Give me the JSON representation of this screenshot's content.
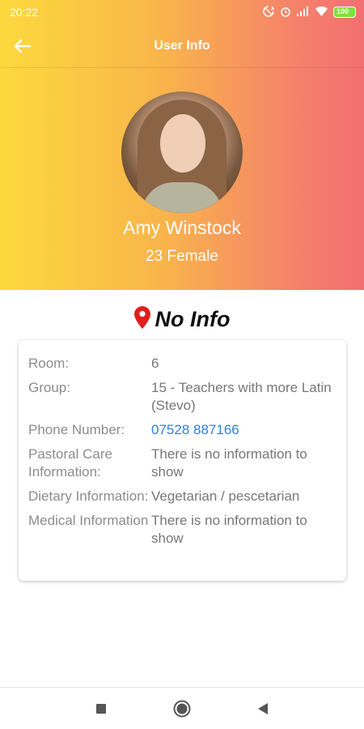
{
  "status_bar": {
    "time": "20:22",
    "battery": "100",
    "icons": [
      "sync-icon",
      "alarm-icon",
      "signal-icon",
      "wifi-icon",
      "battery-icon"
    ]
  },
  "app_bar": {
    "title": "User Info",
    "back_icon": "arrow-left-icon"
  },
  "profile": {
    "name": "Amy Winstock",
    "subtitle": "23 Female"
  },
  "location": {
    "icon": "map-pin-icon",
    "text": "No Info",
    "icon_color": "#e0201e"
  },
  "details": [
    {
      "label": "Room:",
      "value": "6"
    },
    {
      "label": "Group:",
      "value": "15 - Teachers with more Latin (Stevo)"
    },
    {
      "label": "Phone Number:",
      "value": "07528 887166"
    },
    {
      "label": "Pastoral Care Information:",
      "value": "There is no information to show"
    },
    {
      "label": "Dietary Information:",
      "value": "Vegetarian / pescetarian"
    },
    {
      "label": "Medical Information",
      "value": "There is no information to show"
    }
  ],
  "nav": [
    "square-icon",
    "home-circle-icon",
    "back-triangle-icon"
  ],
  "colors": {
    "gradient_start": "#fcd93d",
    "gradient_end": "#f26f72",
    "link": "#2e7fde"
  }
}
